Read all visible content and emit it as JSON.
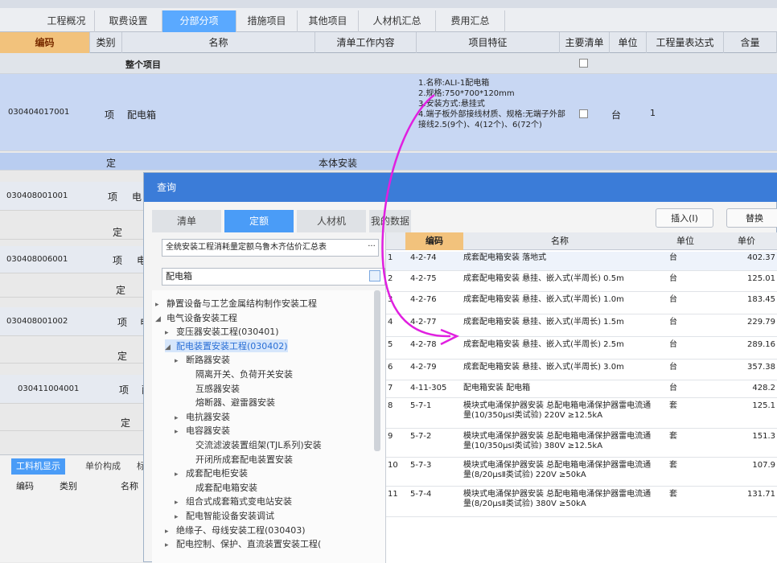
{
  "top_tabs": [
    "工程概况",
    "取费设置",
    "分部分项",
    "措施项目",
    "其他项目",
    "人材机汇总",
    "费用汇总"
  ],
  "active_tab": "分部分项",
  "columns": [
    "编码",
    "类别",
    "名称",
    "清单工作内容",
    "项目特征",
    "主要清单",
    "单位",
    "工程量表达式",
    "含量"
  ],
  "whole_project_label": "整个项目",
  "main_item": {
    "code": "030404017001",
    "type": "项",
    "name": "配电箱",
    "features": [
      "1.名称:ALI-1配电箱",
      "2.规格:750*700*120mm",
      "3.安装方式:悬挂式",
      "4.端子板外部接线材质、规格:无端子外部接线2.5(9个)、4(12个)、6(72个)"
    ],
    "unit": "台",
    "quantity": "1"
  },
  "sub_row": {
    "type": "定",
    "content": "本体安装"
  },
  "left_rows": [
    {
      "code": "030408001001",
      "type": "项",
      "name": "电"
    },
    {
      "code": "",
      "type": "定",
      "name": ""
    },
    {
      "code": "030408006001",
      "type": "项",
      "name": "电"
    },
    {
      "code": "",
      "type": "定",
      "name": ""
    },
    {
      "code": "030408001002",
      "type": "项",
      "name": "电"
    },
    {
      "code": "",
      "type": "定",
      "name": ""
    },
    {
      "code": "030411004001",
      "type": "项",
      "name": "配"
    },
    {
      "code": "",
      "type": "定",
      "name": ""
    }
  ],
  "bottom_panel": {
    "tabs": [
      "工料机显示",
      "单价构成",
      "标"
    ],
    "columns": [
      "编码",
      "类别",
      "名称"
    ]
  },
  "dialog": {
    "title": "查询",
    "tabs": [
      "清单",
      "定额",
      "人材机",
      "我的数据"
    ],
    "active_tab": "定额",
    "insert_button": "插入(I)",
    "replace_button": "替换",
    "quota_library": "全统安装工程消耗量定额乌鲁木齐估价汇总表",
    "search_value": "配电箱",
    "tree": [
      {
        "label": "静置设备与工艺金属结构制作安装工程",
        "level": 1,
        "arrow": "▸"
      },
      {
        "label": "电气设备安装工程",
        "level": 1,
        "arrow": "◢"
      },
      {
        "label": "变压器安装工程(030401)",
        "level": 2,
        "arrow": "▸"
      },
      {
        "label": "配电装置安装工程(030402)",
        "level": 2,
        "arrow": "◢",
        "selected": true
      },
      {
        "label": "断路器安装",
        "level": 3,
        "arrow": "▸"
      },
      {
        "label": "隔离开关、负荷开关安装",
        "level": 4,
        "arrow": ""
      },
      {
        "label": "互感器安装",
        "level": 4,
        "arrow": ""
      },
      {
        "label": "熔断器、避雷器安装",
        "level": 4,
        "arrow": ""
      },
      {
        "label": "电抗器安装",
        "level": 3,
        "arrow": "▸"
      },
      {
        "label": "电容器安装",
        "level": 3,
        "arrow": "▸"
      },
      {
        "label": "交流滤波装置组架(TJL系列)安装",
        "level": 4,
        "arrow": ""
      },
      {
        "label": "开闭所成套配电装置安装",
        "level": 4,
        "arrow": ""
      },
      {
        "label": "成套配电柜安装",
        "level": 3,
        "arrow": "▸"
      },
      {
        "label": "成套配电箱安装",
        "level": 4,
        "arrow": ""
      },
      {
        "label": "组合式成套箱式变电站安装",
        "level": 3,
        "arrow": "▸"
      },
      {
        "label": "配电智能设备安装调试",
        "level": 3,
        "arrow": "▸"
      },
      {
        "label": "绝缘子、母线安装工程(030403)",
        "level": 2,
        "arrow": "▸"
      },
      {
        "label": "配电控制、保护、直流装置安装工程(",
        "level": 2,
        "arrow": "▸"
      }
    ],
    "grid_columns": [
      "编码",
      "名称",
      "单位",
      "单价"
    ],
    "grid_rows": [
      {
        "no": "1",
        "code": "4-2-74",
        "name": "成套配电箱安装 落地式",
        "unit": "台",
        "price": "402.37"
      },
      {
        "no": "2",
        "code": "4-2-75",
        "name": "成套配电箱安装 悬挂、嵌入式(半周长) 0.5m",
        "unit": "台",
        "price": "125.01"
      },
      {
        "no": "3",
        "code": "4-2-76",
        "name": "成套配电箱安装 悬挂、嵌入式(半周长) 1.0m",
        "unit": "台",
        "price": "183.45"
      },
      {
        "no": "4",
        "code": "4-2-77",
        "name": "成套配电箱安装 悬挂、嵌入式(半周长) 1.5m",
        "unit": "台",
        "price": "229.79"
      },
      {
        "no": "5",
        "code": "4-2-78",
        "name": "成套配电箱安装 悬挂、嵌入式(半周长) 2.5m",
        "unit": "台",
        "price": "289.16"
      },
      {
        "no": "6",
        "code": "4-2-79",
        "name": "成套配电箱安装 悬挂、嵌入式(半周长) 3.0m",
        "unit": "台",
        "price": "357.38"
      },
      {
        "no": "7",
        "code": "4-11-305",
        "name": "配电箱安装 配电箱",
        "unit": "台",
        "price": "428.2"
      },
      {
        "no": "8",
        "code": "5-7-1",
        "name": "模块式电涌保护器安装 总配电箱电涌保护器雷电流通量(10/350μsⅠ类试验) 220V ≥12.5kA",
        "unit": "套",
        "price": "125.1"
      },
      {
        "no": "9",
        "code": "5-7-2",
        "name": "模块式电涌保护器安装 总配电箱电涌保护器雷电流通量(10/350μsⅠ类试验) 380V ≥12.5kA",
        "unit": "套",
        "price": "151.3"
      },
      {
        "no": "10",
        "code": "5-7-3",
        "name": "模块式电涌保护器安装 总配电箱电涌保护器雷电流通量(8/20μsⅡ类试验) 220V ≥50kA",
        "unit": "套",
        "price": "107.9"
      },
      {
        "no": "11",
        "code": "5-7-4",
        "name": "模块式电涌保护器安装 总配电箱电涌保护器雷电流通量(8/20μsⅡ类试验) 380V ≥50kA",
        "unit": "套",
        "price": "131.71"
      }
    ]
  },
  "colors": {
    "accent": "#3b7cd8",
    "tab_active": "#5aa9ff",
    "selected_row": "#c8d7f3",
    "code_header": "#f2c27c",
    "annotation": "#e020e0"
  }
}
